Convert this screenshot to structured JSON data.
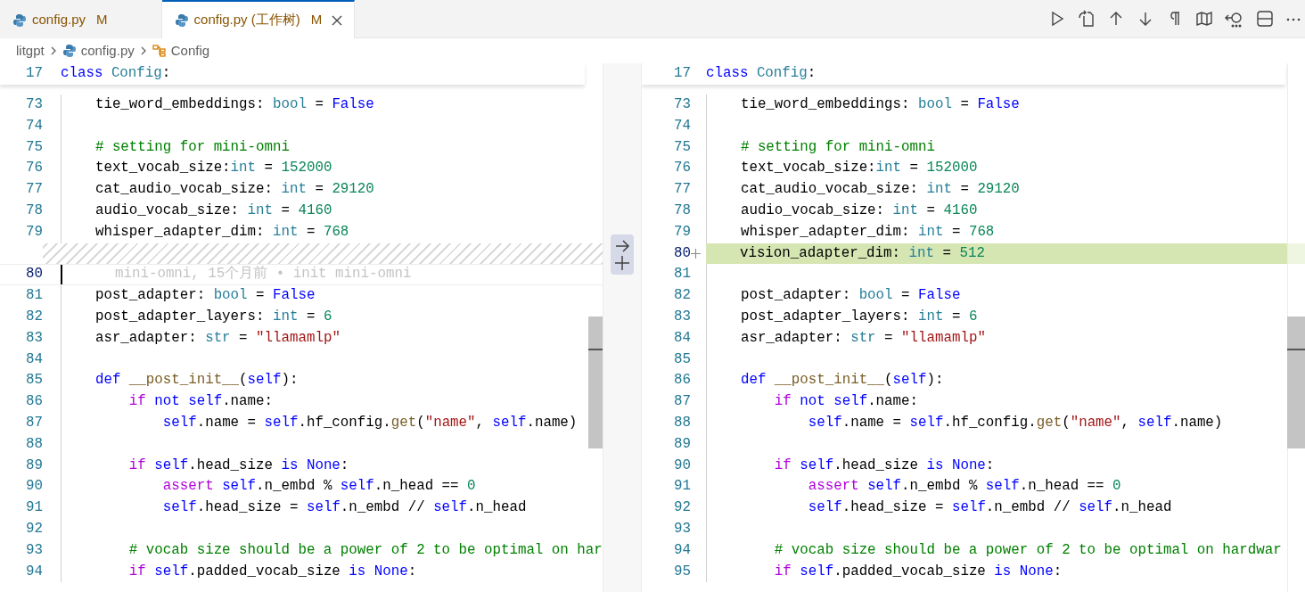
{
  "tabs": [
    {
      "label": "config.py",
      "badge": "M",
      "selected": false
    },
    {
      "label": "config.py (工作树)",
      "badge": "M",
      "selected": true
    }
  ],
  "breadcrumb": [
    {
      "kind": "folder",
      "label": "litgpt"
    },
    {
      "kind": "file",
      "label": "config.py"
    },
    {
      "kind": "class",
      "label": "Config"
    }
  ],
  "left_editor": {
    "sticky": {
      "number": "17",
      "tokens": [
        {
          "kind": "kw",
          "text": "class "
        },
        {
          "kind": "ty",
          "text": "Config"
        },
        {
          "kind": "p",
          "text": ":"
        }
      ]
    },
    "lines": [
      {
        "kind": "normal",
        "number": "73",
        "tokens": [
          {
            "kind": "p",
            "text": "    tie_word_embeddings: "
          },
          {
            "kind": "ty",
            "text": "bool"
          },
          {
            "kind": "p",
            "text": " = "
          },
          {
            "kind": "kw",
            "text": "False"
          }
        ]
      },
      {
        "kind": "normal",
        "number": "74"
      },
      {
        "kind": "normal",
        "number": "75",
        "tokens": [
          {
            "kind": "cm",
            "text": "    # setting for mini-omni"
          }
        ]
      },
      {
        "kind": "normal",
        "number": "76",
        "tokens": [
          {
            "kind": "p",
            "text": "    text_vocab_size:"
          },
          {
            "kind": "ty",
            "text": "int"
          },
          {
            "kind": "p",
            "text": " = "
          },
          {
            "kind": "nu",
            "text": "152000"
          }
        ]
      },
      {
        "kind": "normal",
        "number": "77",
        "tokens": [
          {
            "kind": "p",
            "text": "    cat_audio_vocab_size: "
          },
          {
            "kind": "ty",
            "text": "int"
          },
          {
            "kind": "p",
            "text": " = "
          },
          {
            "kind": "nu",
            "text": "29120"
          }
        ]
      },
      {
        "kind": "normal",
        "number": "78",
        "tokens": [
          {
            "kind": "p",
            "text": "    audio_vocab_size: "
          },
          {
            "kind": "ty",
            "text": "int"
          },
          {
            "kind": "p",
            "text": " = "
          },
          {
            "kind": "nu",
            "text": "4160"
          }
        ]
      },
      {
        "kind": "normal",
        "number": "79",
        "tokens": [
          {
            "kind": "p",
            "text": "    whisper_adapter_dim: "
          },
          {
            "kind": "ty",
            "text": "int"
          },
          {
            "kind": "p",
            "text": " = "
          },
          {
            "kind": "nu",
            "text": "768"
          }
        ]
      },
      {
        "kind": "spacer"
      },
      {
        "kind": "current",
        "number": "80",
        "blame": "mini-omni, 15个月前 • init mini-omni"
      },
      {
        "kind": "normal",
        "number": "81",
        "tokens": [
          {
            "kind": "p",
            "text": "    post_adapter: "
          },
          {
            "kind": "ty",
            "text": "bool"
          },
          {
            "kind": "p",
            "text": " = "
          },
          {
            "kind": "kw",
            "text": "False"
          }
        ]
      },
      {
        "kind": "normal",
        "number": "82",
        "tokens": [
          {
            "kind": "p",
            "text": "    post_adapter_layers: "
          },
          {
            "kind": "ty",
            "text": "int"
          },
          {
            "kind": "p",
            "text": " = "
          },
          {
            "kind": "nu",
            "text": "6"
          }
        ]
      },
      {
        "kind": "normal",
        "number": "83",
        "tokens": [
          {
            "kind": "p",
            "text": "    asr_adapter: "
          },
          {
            "kind": "ty",
            "text": "str"
          },
          {
            "kind": "p",
            "text": " = "
          },
          {
            "kind": "st",
            "text": "\"llamamlp\""
          }
        ]
      },
      {
        "kind": "normal",
        "number": "84"
      },
      {
        "kind": "normal",
        "number": "85",
        "tokens": [
          {
            "kind": "kw",
            "text": "    def "
          },
          {
            "kind": "fn",
            "text": "__post_init__"
          },
          {
            "kind": "p",
            "text": "("
          },
          {
            "kind": "kw",
            "text": "self"
          },
          {
            "kind": "p",
            "text": "):"
          }
        ]
      },
      {
        "kind": "normal",
        "number": "86",
        "tokens": [
          {
            "kind": "ct",
            "text": "        if "
          },
          {
            "kind": "kw",
            "text": "not self"
          },
          {
            "kind": "p",
            "text": ".name:"
          }
        ]
      },
      {
        "kind": "normal",
        "number": "87",
        "tokens": [
          {
            "kind": "kw",
            "text": "            self"
          },
          {
            "kind": "p",
            "text": ".name = "
          },
          {
            "kind": "kw",
            "text": "self"
          },
          {
            "kind": "p",
            "text": ".hf_config."
          },
          {
            "kind": "fn",
            "text": "get"
          },
          {
            "kind": "p",
            "text": "("
          },
          {
            "kind": "st",
            "text": "\"name\""
          },
          {
            "kind": "p",
            "text": ", "
          },
          {
            "kind": "kw",
            "text": "self"
          },
          {
            "kind": "p",
            "text": ".name)"
          }
        ]
      },
      {
        "kind": "normal",
        "number": "88"
      },
      {
        "kind": "normal",
        "number": "89",
        "tokens": [
          {
            "kind": "ct",
            "text": "        if "
          },
          {
            "kind": "kw",
            "text": "self"
          },
          {
            "kind": "p",
            "text": ".head_size "
          },
          {
            "kind": "kw",
            "text": "is None"
          },
          {
            "kind": "p",
            "text": ":"
          }
        ]
      },
      {
        "kind": "normal",
        "number": "90",
        "tokens": [
          {
            "kind": "ct",
            "text": "            assert "
          },
          {
            "kind": "kw",
            "text": "self"
          },
          {
            "kind": "p",
            "text": ".n_embd % "
          },
          {
            "kind": "kw",
            "text": "self"
          },
          {
            "kind": "p",
            "text": ".n_head == "
          },
          {
            "kind": "nu",
            "text": "0"
          }
        ]
      },
      {
        "kind": "normal",
        "number": "91",
        "tokens": [
          {
            "kind": "kw",
            "text": "            self"
          },
          {
            "kind": "p",
            "text": ".head_size = "
          },
          {
            "kind": "kw",
            "text": "self"
          },
          {
            "kind": "p",
            "text": ".n_embd // "
          },
          {
            "kind": "kw",
            "text": "self"
          },
          {
            "kind": "p",
            "text": ".n_head"
          }
        ]
      },
      {
        "kind": "normal",
        "number": "92"
      },
      {
        "kind": "normal",
        "number": "93",
        "tokens": [
          {
            "kind": "cm",
            "text": "        # vocab size should be a power of 2 to be optimal on har"
          }
        ]
      },
      {
        "kind": "normal",
        "number": "94",
        "tokens": [
          {
            "kind": "ct",
            "text": "        if "
          },
          {
            "kind": "kw",
            "text": "self"
          },
          {
            "kind": "p",
            "text": ".padded_vocab_size "
          },
          {
            "kind": "kw",
            "text": "is None"
          },
          {
            "kind": "p",
            "text": ":"
          }
        ]
      }
    ]
  },
  "right_editor": {
    "sticky": {
      "number": "17",
      "tokens": [
        {
          "kind": "kw",
          "text": "class "
        },
        {
          "kind": "ty",
          "text": "Config"
        },
        {
          "kind": "p",
          "text": ":"
        }
      ]
    },
    "lines": [
      {
        "kind": "normal",
        "number": "73",
        "tokens": [
          {
            "kind": "p",
            "text": "    tie_word_embeddings: "
          },
          {
            "kind": "ty",
            "text": "bool"
          },
          {
            "kind": "p",
            "text": " = "
          },
          {
            "kind": "kw",
            "text": "False"
          }
        ]
      },
      {
        "kind": "normal",
        "number": "74"
      },
      {
        "kind": "normal",
        "number": "75",
        "tokens": [
          {
            "kind": "cm",
            "text": "    # setting for mini-omni"
          }
        ]
      },
      {
        "kind": "normal",
        "number": "76",
        "tokens": [
          {
            "kind": "p",
            "text": "    text_vocab_size:"
          },
          {
            "kind": "ty",
            "text": "int"
          },
          {
            "kind": "p",
            "text": " = "
          },
          {
            "kind": "nu",
            "text": "152000"
          }
        ]
      },
      {
        "kind": "normal",
        "number": "77",
        "tokens": [
          {
            "kind": "p",
            "text": "    cat_audio_vocab_size: "
          },
          {
            "kind": "ty",
            "text": "int"
          },
          {
            "kind": "p",
            "text": " = "
          },
          {
            "kind": "nu",
            "text": "29120"
          }
        ]
      },
      {
        "kind": "normal",
        "number": "78",
        "tokens": [
          {
            "kind": "p",
            "text": "    audio_vocab_size: "
          },
          {
            "kind": "ty",
            "text": "int"
          },
          {
            "kind": "p",
            "text": " = "
          },
          {
            "kind": "nu",
            "text": "4160"
          }
        ]
      },
      {
        "kind": "normal",
        "number": "79",
        "tokens": [
          {
            "kind": "p",
            "text": "    whisper_adapter_dim: "
          },
          {
            "kind": "ty",
            "text": "int"
          },
          {
            "kind": "p",
            "text": " = "
          },
          {
            "kind": "nu",
            "text": "768"
          }
        ]
      },
      {
        "kind": "added",
        "number": "80",
        "tokens": [
          {
            "kind": "p",
            "text": "    vision_adapter_dim: "
          },
          {
            "kind": "ty",
            "text": "int"
          },
          {
            "kind": "p",
            "text": " = "
          },
          {
            "kind": "nu",
            "text": "512"
          }
        ]
      },
      {
        "kind": "normal",
        "number": "81"
      },
      {
        "kind": "normal",
        "number": "82",
        "tokens": [
          {
            "kind": "p",
            "text": "    post_adapter: "
          },
          {
            "kind": "ty",
            "text": "bool"
          },
          {
            "kind": "p",
            "text": " = "
          },
          {
            "kind": "kw",
            "text": "False"
          }
        ]
      },
      {
        "kind": "normal",
        "number": "83",
        "tokens": [
          {
            "kind": "p",
            "text": "    post_adapter_layers: "
          },
          {
            "kind": "ty",
            "text": "int"
          },
          {
            "kind": "p",
            "text": " = "
          },
          {
            "kind": "nu",
            "text": "6"
          }
        ]
      },
      {
        "kind": "normal",
        "number": "84",
        "tokens": [
          {
            "kind": "p",
            "text": "    asr_adapter: "
          },
          {
            "kind": "ty",
            "text": "str"
          },
          {
            "kind": "p",
            "text": " = "
          },
          {
            "kind": "st",
            "text": "\"llamamlp\""
          }
        ]
      },
      {
        "kind": "normal",
        "number": "85"
      },
      {
        "kind": "normal",
        "number": "86",
        "tokens": [
          {
            "kind": "kw",
            "text": "    def "
          },
          {
            "kind": "fn",
            "text": "__post_init__"
          },
          {
            "kind": "p",
            "text": "("
          },
          {
            "kind": "kw",
            "text": "self"
          },
          {
            "kind": "p",
            "text": "):"
          }
        ]
      },
      {
        "kind": "normal",
        "number": "87",
        "tokens": [
          {
            "kind": "ct",
            "text": "        if "
          },
          {
            "kind": "kw",
            "text": "not self"
          },
          {
            "kind": "p",
            "text": ".name:"
          }
        ]
      },
      {
        "kind": "normal",
        "number": "88",
        "tokens": [
          {
            "kind": "kw",
            "text": "            self"
          },
          {
            "kind": "p",
            "text": ".name = "
          },
          {
            "kind": "kw",
            "text": "self"
          },
          {
            "kind": "p",
            "text": ".hf_config."
          },
          {
            "kind": "fn",
            "text": "get"
          },
          {
            "kind": "p",
            "text": "("
          },
          {
            "kind": "st",
            "text": "\"name\""
          },
          {
            "kind": "p",
            "text": ", "
          },
          {
            "kind": "kw",
            "text": "self"
          },
          {
            "kind": "p",
            "text": ".name)"
          }
        ]
      },
      {
        "kind": "normal",
        "number": "89"
      },
      {
        "kind": "normal",
        "number": "90",
        "tokens": [
          {
            "kind": "ct",
            "text": "        if "
          },
          {
            "kind": "kw",
            "text": "self"
          },
          {
            "kind": "p",
            "text": ".head_size "
          },
          {
            "kind": "kw",
            "text": "is None"
          },
          {
            "kind": "p",
            "text": ":"
          }
        ]
      },
      {
        "kind": "normal",
        "number": "91",
        "tokens": [
          {
            "kind": "ct",
            "text": "            assert "
          },
          {
            "kind": "kw",
            "text": "self"
          },
          {
            "kind": "p",
            "text": ".n_embd % "
          },
          {
            "kind": "kw",
            "text": "self"
          },
          {
            "kind": "p",
            "text": ".n_head == "
          },
          {
            "kind": "nu",
            "text": "0"
          }
        ]
      },
      {
        "kind": "normal",
        "number": "92",
        "tokens": [
          {
            "kind": "kw",
            "text": "            self"
          },
          {
            "kind": "p",
            "text": ".head_size = "
          },
          {
            "kind": "kw",
            "text": "self"
          },
          {
            "kind": "p",
            "text": ".n_embd // "
          },
          {
            "kind": "kw",
            "text": "self"
          },
          {
            "kind": "p",
            "text": ".n_head"
          }
        ]
      },
      {
        "kind": "normal",
        "number": "93"
      },
      {
        "kind": "normal",
        "number": "94",
        "tokens": [
          {
            "kind": "cm",
            "text": "        # vocab size should be a power of 2 to be optimal on hardwar"
          }
        ]
      },
      {
        "kind": "normal",
        "number": "95",
        "tokens": [
          {
            "kind": "ct",
            "text": "        if "
          },
          {
            "kind": "kw",
            "text": "self"
          },
          {
            "kind": "p",
            "text": ".padded_vocab_size "
          },
          {
            "kind": "kw",
            "text": "is None"
          },
          {
            "kind": "p",
            "text": ":"
          }
        ]
      }
    ]
  }
}
